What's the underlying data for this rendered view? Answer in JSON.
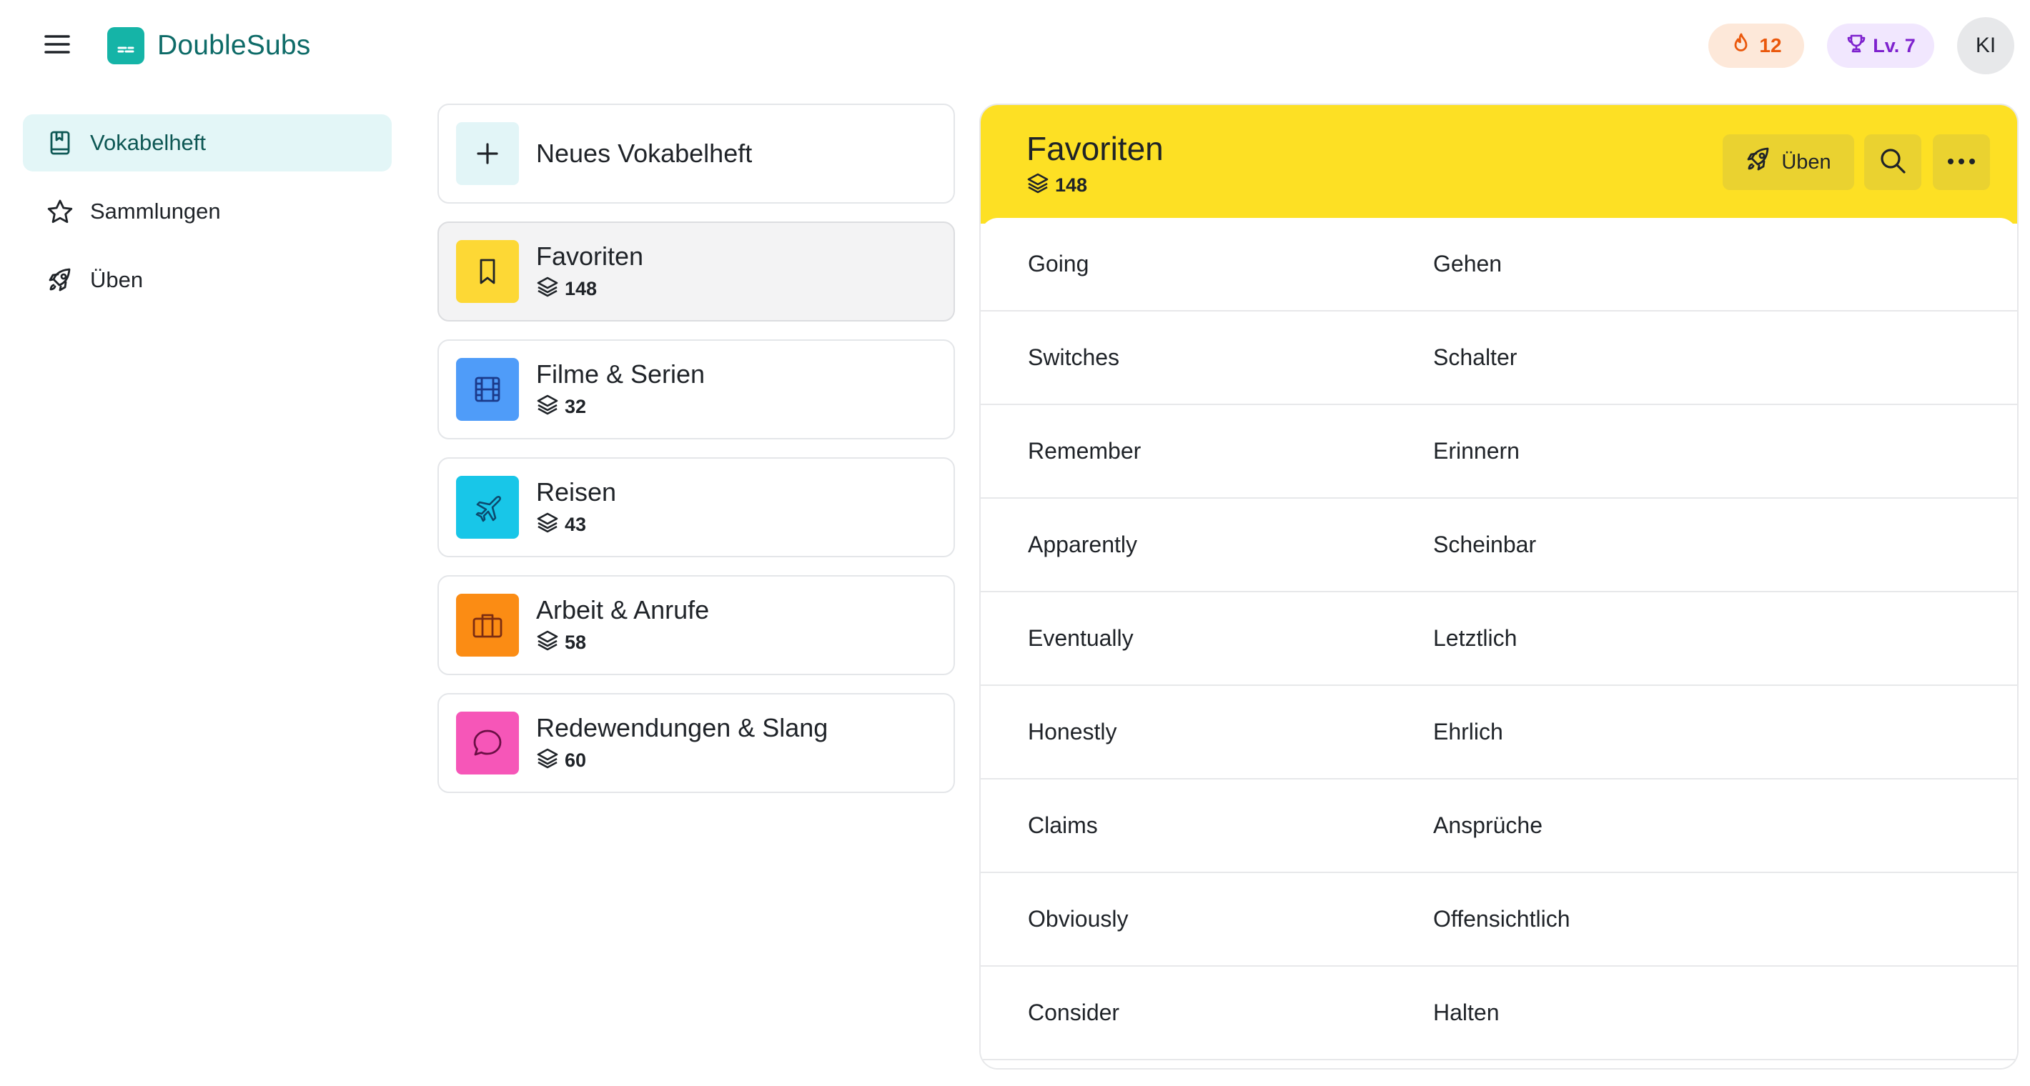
{
  "app": {
    "name": "DoubleSubs",
    "menu_icon": "hamburger-menu-icon",
    "logo_icon": "subtitles-icon"
  },
  "header": {
    "streak": {
      "icon": "flame-icon",
      "value": "12",
      "color": "#ea580c"
    },
    "level": {
      "icon": "trophy-icon",
      "label": "Lv. 7",
      "color": "#7e22ce"
    },
    "avatar_initials": "KI"
  },
  "sidebar": {
    "items": [
      {
        "label": "Vokabelheft",
        "icon": "notebook-icon",
        "active": true
      },
      {
        "label": "Sammlungen",
        "icon": "star-icon",
        "active": false
      },
      {
        "label": "Üben",
        "icon": "rocket-icon",
        "active": false
      }
    ]
  },
  "notebooks": {
    "new_label": "Neues Vokabelheft",
    "items": [
      {
        "title": "Favoriten",
        "count": "148",
        "icon": "bookmark-icon",
        "color": "#fdd835",
        "selected": true
      },
      {
        "title": "Filme & Serien",
        "count": "32",
        "icon": "film-icon",
        "color": "#4f9cf9",
        "selected": false
      },
      {
        "title": "Reisen",
        "count": "43",
        "icon": "plane-icon",
        "color": "#18c6e8",
        "selected": false
      },
      {
        "title": "Arbeit & Anrufe",
        "count": "58",
        "icon": "briefcase-icon",
        "color": "#fb8c14",
        "selected": false
      },
      {
        "title": "Redewendungen & Slang",
        "count": "60",
        "icon": "speech-bubble-icon",
        "color": "#f656b8",
        "selected": false
      }
    ]
  },
  "detail": {
    "title": "Favoriten",
    "count": "148",
    "accent": "#fde024",
    "practice_label": "Üben",
    "words": [
      {
        "source": "Going",
        "target": "Gehen"
      },
      {
        "source": "Switches",
        "target": "Schalter"
      },
      {
        "source": "Remember",
        "target": "Erinnern"
      },
      {
        "source": "Apparently",
        "target": "Scheinbar"
      },
      {
        "source": "Eventually",
        "target": "Letztlich"
      },
      {
        "source": "Honestly",
        "target": "Ehrlich"
      },
      {
        "source": "Claims",
        "target": "Ansprüche"
      },
      {
        "source": "Obviously",
        "target": "Offensichtlich"
      },
      {
        "source": "Consider",
        "target": "Halten"
      }
    ]
  }
}
